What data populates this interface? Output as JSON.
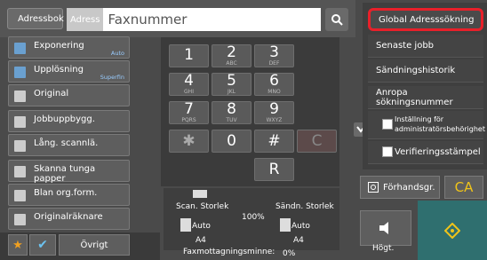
{
  "header": {
    "address_book_label": "Adressbok",
    "address_prefix": "Adress",
    "fax_placeholder": "Faxnummer"
  },
  "left_buttons": [
    {
      "label": "Exponering",
      "sub": "Auto"
    },
    {
      "label": "Upplösning",
      "sub": "Superfin"
    },
    {
      "label": "Original",
      "sub": ""
    },
    {
      "label": "Jobbuppbygg.",
      "sub": ""
    },
    {
      "label": "Lång. scannlä.",
      "sub": ""
    },
    {
      "label": "Skanna tunga papper",
      "sub": ""
    },
    {
      "label": "Blan org.form.",
      "sub": ""
    },
    {
      "label": "Originalräknare",
      "sub": ""
    }
  ],
  "bottom": {
    "other_label": "Övrigt"
  },
  "keypad": [
    {
      "main": "1",
      "sub": ""
    },
    {
      "main": "2",
      "sub": "ABC"
    },
    {
      "main": "3",
      "sub": "DEF"
    },
    {
      "main": "4",
      "sub": "GHI"
    },
    {
      "main": "5",
      "sub": "JKL"
    },
    {
      "main": "6",
      "sub": "MNO"
    },
    {
      "main": "7",
      "sub": "PQRS"
    },
    {
      "main": "8",
      "sub": "TUV"
    },
    {
      "main": "9",
      "sub": "WXYZ"
    },
    {
      "main": "✱",
      "sub": ""
    },
    {
      "main": "0",
      "sub": ""
    },
    {
      "main": "#",
      "sub": ""
    },
    {
      "main": "C",
      "sub": ""
    },
    {
      "main": "R",
      "sub": ""
    }
  ],
  "status": {
    "scan_size_label": "Scan. Storlek",
    "scan_auto": "Auto",
    "scan_paper": "A4",
    "ratio": "100%",
    "send_size_label": "Sändn. Storlek",
    "send_auto": "Auto",
    "send_paper": "A4",
    "memory_label": "Faxmottagningsminne:",
    "memory_value": "0%"
  },
  "menu": {
    "items": [
      "Global Adresssökning",
      "Senaste jobb",
      "Sändningshistorik",
      "Anropa sökningsnummer"
    ],
    "check_items": [
      "Inställning för administratörsbehörighet",
      "Verifieringsstämpel"
    ]
  },
  "right_controls": {
    "preview_label": "Förhandsgr.",
    "ca_label": "CA",
    "volume_label": "Högt."
  },
  "colors": {
    "highlight": "#e8202a",
    "accent_yellow": "#f0c419",
    "teal": "#2f6f6f"
  }
}
